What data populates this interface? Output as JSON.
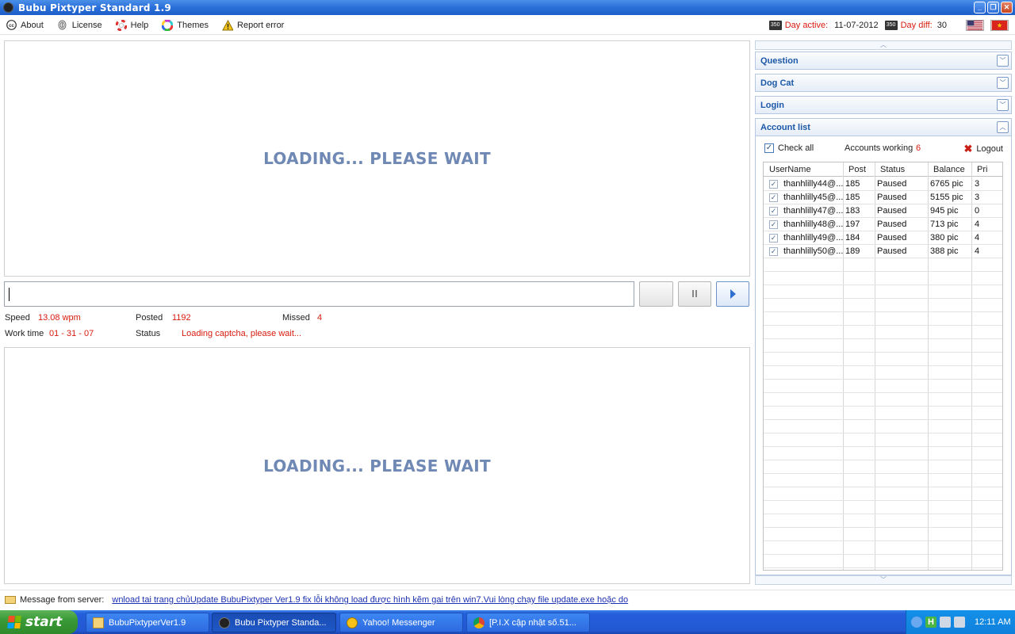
{
  "window": {
    "title": "Bubu Pixtyper Standard 1.9"
  },
  "menu": {
    "items": [
      {
        "label": "About",
        "icon": "cc-icon"
      },
      {
        "label": "License",
        "icon": "fingerprint-icon"
      },
      {
        "label": "Help",
        "icon": "lifebuoy-icon"
      },
      {
        "label": "Themes",
        "icon": "color-wheel-icon"
      },
      {
        "label": "Report error",
        "icon": "warning-icon"
      }
    ],
    "day_active_label": "Day active:",
    "day_active_value": "11-07-2012",
    "day_diff_label": "Day diff:",
    "day_diff_value": "30",
    "calendar_text": "350"
  },
  "captcha": {
    "top_loading": "LOADING... PLEASE WAIT",
    "bottom_loading": "LOADING... PLEASE WAIT",
    "answer_value": ""
  },
  "stats": {
    "speed_label": "Speed",
    "speed_value": "13.08 wpm",
    "posted_label": "Posted",
    "posted_value": "1192",
    "missed_label": "Missed",
    "missed_value": "4",
    "worktime_label": "Work time",
    "worktime_value": "01 - 31 - 07",
    "status_label": "Status",
    "status_value": "Loading captcha, please wait..."
  },
  "panels": {
    "question": "Question",
    "dogcat": "Dog Cat",
    "login": "Login",
    "account_list": "Account list"
  },
  "accounts": {
    "check_all": "Check all",
    "working_label": "Accounts working",
    "working_count": "6",
    "logout": "Logout",
    "columns": [
      "UserName",
      "Post",
      "Status",
      "Balance",
      "Pri"
    ],
    "rows": [
      {
        "user": "thanhlilly44@...",
        "post": "185",
        "status": "Paused",
        "balance": "6765 pic",
        "pri": "3"
      },
      {
        "user": "thanhlilly45@...",
        "post": "185",
        "status": "Paused",
        "balance": "5155 pic",
        "pri": "3"
      },
      {
        "user": "thanhlilly47@...",
        "post": "183",
        "status": "Paused",
        "balance": "945 pic",
        "pri": "0"
      },
      {
        "user": "thanhlilly48@...",
        "post": "197",
        "status": "Paused",
        "balance": "713 pic",
        "pri": "4"
      },
      {
        "user": "thanhlilly49@...",
        "post": "184",
        "status": "Paused",
        "balance": "380 pic",
        "pri": "4"
      },
      {
        "user": "thanhlilly50@...",
        "post": "189",
        "status": "Paused",
        "balance": "388 pic",
        "pri": "4"
      }
    ]
  },
  "server": {
    "label": "Message from server:",
    "message": "wnload tai trang chủUpdate BubuPixtyper Ver1.9 fix lỗi không load được hình kẽm gai trên win7.Vui lòng chạy file update.exe hoặc do"
  },
  "taskbar": {
    "start": "start",
    "tasks": [
      {
        "label": "BubuPixtyperVer1.9",
        "icon": "folder-icon",
        "active": false
      },
      {
        "label": "Bubu Pixtyper Standa...",
        "icon": "app-icon",
        "active": true
      },
      {
        "label": "Yahoo! Messenger",
        "icon": "smiley-icon",
        "active": false
      },
      {
        "label": "[P.I.X cập nhật số.51...",
        "icon": "chrome-icon",
        "active": false
      }
    ],
    "clock": "12:11 AM"
  },
  "colors": {
    "accent_red": "#d81b0f",
    "panel_title": "#1c58a8",
    "loading_text": "#6f88b4"
  }
}
